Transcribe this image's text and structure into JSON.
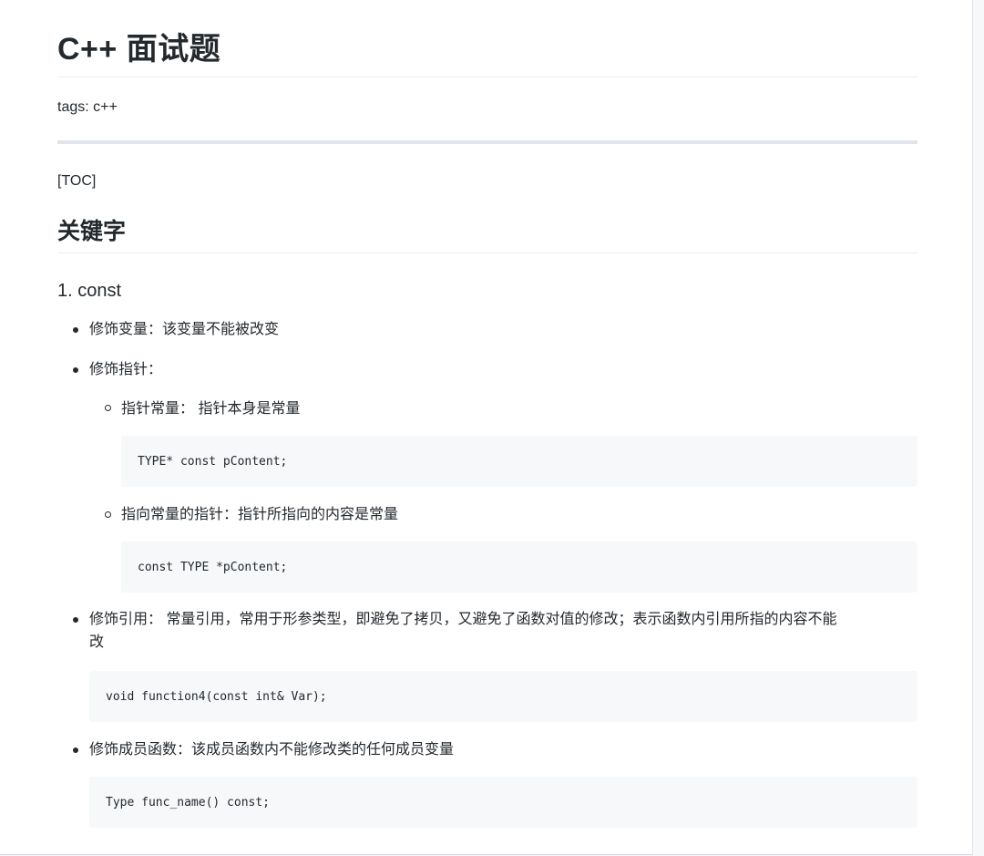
{
  "title": "C++ 面试题",
  "tags": "tags: c++",
  "toc": "[TOC]",
  "section_heading": "关键字",
  "subsection_heading": "1. const",
  "items": {
    "variable": "修饰变量：该变量不能被改变",
    "pointer": "修饰指针：",
    "pointer_const": "指针常量： 指针本身是常量",
    "pointer_const_code": "TYPE* const pContent;",
    "pointer_to_const": "指向常量的指针：指针所指向的内容是常量",
    "pointer_to_const_code": "const TYPE *pContent;",
    "reference_line1": "修饰引用： 常量引用，常用于形参类型，即避免了拷贝，又避免了函数对值的修改；表示函数内引用所指的内容不能",
    "reference_line2": "改",
    "reference_code": "void function4(const int& Var);",
    "member_function": "修饰成员函数：该成员函数内不能修改类的任何成员变量",
    "member_function_code": "Type func_name() const;"
  }
}
